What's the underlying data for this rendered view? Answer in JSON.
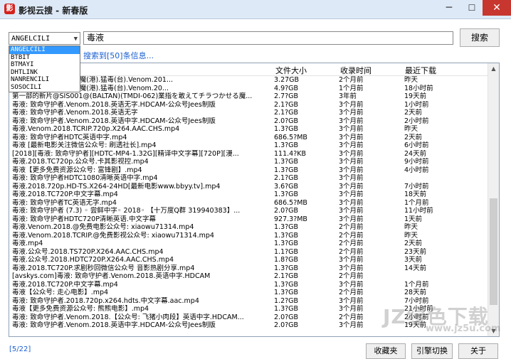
{
  "window": {
    "title": "影视云搜 - 新春版",
    "icon_glyph": "影",
    "minimize": "─",
    "maximize": "☐",
    "close": "✕"
  },
  "search": {
    "engine_selected": "ANGELCILI",
    "engine_options": [
      "ANGELCILI",
      "BTBIT",
      "BTMAYI",
      "DHTLINK",
      "NANRENCILI",
      "SOSOCILI"
    ],
    "query": "毒液",
    "button_label": "搜索"
  },
  "status_message": "搜索到[50]条信息...",
  "columns": {
    "name": "",
    "size": "文件大小",
    "time": "收录时间",
    "last_download": "最近下载"
  },
  "rows": [
    {
      "name": "】毒液: 致命守护者.毒魔(港).猛毒(台).Venom.201...",
      "size": "3.27GB",
      "time": "2个月前",
      "dl": "昨天"
    },
    {
      "name": "】毒液: 致命守护者.毒魔(港).猛毒(台).Venom.20...",
      "size": "4.9?GB",
      "time": "1个月前",
      "dl": "18小时前"
    },
    {
      "name": "第一部的新片@SIS001@(BALTAN)(TMDI-062)業指を敢えてチラつかせる魔...",
      "size": "2.7?GB",
      "time": "3年前",
      "dl": "19天前"
    },
    {
      "name": "毒液: 致命守护者.Venom.2018.英语无字.HDCAM-公众号Jees制版",
      "size": "2.1?GB",
      "time": "3个月前",
      "dl": "1小时前"
    },
    {
      "name": "毒液: 致命守护者.Venom.2018.英语无字",
      "size": "2.1?GB",
      "time": "3个月前",
      "dl": "2天前"
    },
    {
      "name": "毒液: 致命守护者.Venom.2018.英语中字.HDCAM-公众号Jees制版",
      "size": "2.0?GB",
      "time": "3个月前",
      "dl": "2小时前"
    },
    {
      "name": "毒液.Venom.2018.TCRIP.720p.X264.AAC.CHS.mp4",
      "size": "1.3?GB",
      "time": "3个月前",
      "dl": "昨天"
    },
    {
      "name": "毒液: 致命守护者HDTC英语中字.mp4",
      "size": "686.5?MB",
      "time": "3个月前",
      "dl": "2天前"
    },
    {
      "name": "毒液 [最新电影关注微信公众号: 刷透社长].mp4",
      "size": "1.3?GB",
      "time": "3个月前",
      "dl": "6小时前"
    },
    {
      "name": "[2018][毒液: 致命守护者][HDTC-MP4-1.32G][精译中文字幕][720P][漫...",
      "size": "111.4?KB",
      "time": "3个月前",
      "dl": "24天前"
    },
    {
      "name": "毒液.2018.TC720p.公众号.卡其影视控.mp4",
      "size": "1.3?GB",
      "time": "3个月前",
      "dl": "9小时前"
    },
    {
      "name": "毒液【更多免费资源公众号: 富锋剧】.mp4",
      "size": "1.3?GB",
      "time": "3个月前",
      "dl": "4小时前"
    },
    {
      "name": "毒液: 致命守护者HDTC1080清晰英语中字.mp4",
      "size": "2.1?GB",
      "time": "3个月前",
      "dl": ""
    },
    {
      "name": "毒液.2018.720p.HD-TS.X264-24HD[最新电影www.bbyy.tv].mp4",
      "size": "3.6?GB",
      "time": "3个月前",
      "dl": "7小时前"
    },
    {
      "name": "毒液.2018.TC720P.中文字幕.mp4",
      "size": "1.3?GB",
      "time": "3个月前",
      "dl": "18天前"
    },
    {
      "name": "毒液: 致命守护者TC英语无字.mp4",
      "size": "686.5?MB",
      "time": "3个月前",
      "dl": "1个月前"
    },
    {
      "name": "毒液: 致命守护者 (7.3) ◦ 尝鲜中字◦ 2018◦ 【十万度Q群 319940383】...",
      "size": "2.0?GB",
      "time": "3个月前",
      "dl": "11小时前"
    },
    {
      "name": "毒液: 致命守护者HDTC720P清晰英语.中文字幕",
      "size": "927.3?MB",
      "time": "3个月前",
      "dl": "1天前"
    },
    {
      "name": "毒液.Venom.2018.@免费电影公众号: xiaowu71314.mp4",
      "size": "1.3?GB",
      "time": "2个月前",
      "dl": "昨天"
    },
    {
      "name": "毒液.Venom.2018.TCRIP.@免费影视公众号: xiaowu71314.mp4",
      "size": "1.3?GB",
      "time": "2个月前",
      "dl": "昨天"
    },
    {
      "name": "毒液.mp4",
      "size": "1.3?GB",
      "time": "2个月前",
      "dl": "2天前"
    },
    {
      "name": "毒液.公众号.2018.TS720P.X264.AAC.CHS.mp4",
      "size": "1.1?GB",
      "time": "2个月前",
      "dl": "23天前"
    },
    {
      "name": "毒液.公众号.2018.HDTC720P.X264.AAC.CHS.mp4",
      "size": "1.8?GB",
      "time": "3个月前",
      "dl": "3天前"
    },
    {
      "name": "毒液.2018.TC720P.求剧秒回微信公众号  音影热剧分享.mp4",
      "size": "1.3?GB",
      "time": "3个月前",
      "dl": "14天前"
    },
    {
      "name": "[avskys.com]毒液: 致命守护者.Venom.2018.英语中字.HDCAM",
      "size": "2.1?GB",
      "time": "2个月前",
      "dl": ""
    },
    {
      "name": "毒液.2018.TC720P.中文字幕.mp4",
      "size": "1.3?GB",
      "time": "3个月前",
      "dl": "1个月前"
    },
    {
      "name": "毒液【公众号: 走心电影】.mp4",
      "size": "1.3?GB",
      "time": "2个月前",
      "dl": "28天前"
    },
    {
      "name": "毒液: 致命守护者.2018.720p.x264.hdts.中文字幕.aac.mp4",
      "size": "1.2?GB",
      "time": "3个月前",
      "dl": "7小时前"
    },
    {
      "name": "毒液【更多免费资源公众号: 熊熊电影】.mp4",
      "size": "1.3?GB",
      "time": "3个月前",
      "dl": "21小时前"
    },
    {
      "name": "毒液: 致命守护者.Venom.2018.【公众号: 飞猪小肉段】英语中字.HDCAM...",
      "size": "2.0?GB",
      "time": "2个月前",
      "dl": "2小时前"
    },
    {
      "name": "毒液: 致命守护者.Venom.2018.英语中字.HDCAM-公众号Jees制版",
      "size": "2.0?GB",
      "time": "3个月前",
      "dl": "19天前"
    }
  ],
  "footer": {
    "page_indicator": "[5/22]",
    "favorite_button": "收藏夹",
    "switch_engine_button": "引擎切换",
    "close_button": "关于"
  },
  "watermark": {
    "brand": "JZ绿色下载",
    "url": "www.jz5u.com"
  }
}
